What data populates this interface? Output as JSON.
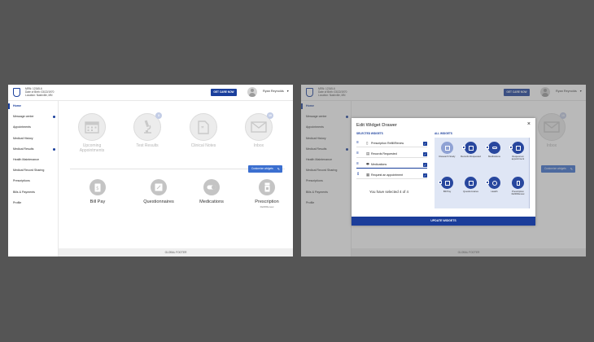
{
  "patient": {
    "mrn": "MRN: 12345-6",
    "dob": "Date of Birth: 03/22/1970",
    "location": "Location: Nashville, MN"
  },
  "header": {
    "care_button": "GET CARE NOW",
    "user_name": "Ryan Reynolds"
  },
  "sidebar": {
    "items": [
      {
        "label": "Home"
      },
      {
        "label": "Message center"
      },
      {
        "label": "Appointments"
      },
      {
        "label": "Medical History"
      },
      {
        "label": "Medical Results"
      },
      {
        "label": "Health Maintenance"
      },
      {
        "label": "Medical Record Sharing"
      },
      {
        "label": "Prescriptions"
      },
      {
        "label": "Bills & Payments"
      },
      {
        "label": "Profile"
      }
    ]
  },
  "dashboard": {
    "faint_widgets": [
      {
        "label": "Upcoming Appointments",
        "icon": "calendar-icon"
      },
      {
        "label": "Test Results",
        "icon": "microscope-icon",
        "badge": "3"
      },
      {
        "label": "Clinical Notes",
        "icon": "notes-icon"
      },
      {
        "label": "Inbox",
        "icon": "envelope-icon",
        "badge": "10"
      }
    ],
    "customize_button": "Customize widgets",
    "widgets": [
      {
        "label": "Bill Pay",
        "icon": "bill-icon"
      },
      {
        "label": "Questionnaires",
        "icon": "clipboard-icon"
      },
      {
        "label": "Medications",
        "icon": "pill-icon"
      },
      {
        "label": "Prescription",
        "sublabel": "Refill/Renew",
        "icon": "prescription-icon"
      }
    ],
    "footer": "GLOBAL FOOTER"
  },
  "modal": {
    "title": "Edit Widget Drawer",
    "close": "×",
    "selected_heading": "SELECTED WIDGETS",
    "all_heading": "ALL WIDGETS",
    "selected": [
      {
        "label": "Prescription Refill/Renew",
        "icon": "prescription-icon"
      },
      {
        "label": "Records Requested",
        "icon": "records-icon"
      },
      {
        "label": "Medications",
        "icon": "pill-icon"
      },
      {
        "label": "Request an appointment",
        "icon": "calendar-icon"
      }
    ],
    "count_text": "You have selected 4 of 4",
    "all_widgets": [
      {
        "label": "Research Study",
        "icon": "research-icon",
        "selected": false
      },
      {
        "label": "Records Requested",
        "icon": "records-icon",
        "selected": true
      },
      {
        "label": "Medications",
        "icon": "pill-icon",
        "selected": true
      },
      {
        "label": "Request an appointment",
        "icon": "calendar-icon",
        "selected": true
      },
      {
        "label": "Bill Pay",
        "icon": "bill-icon",
        "selected": false
      },
      {
        "label": "Questionnaires",
        "icon": "clipboard-icon",
        "selected": false
      },
      {
        "label": "Health",
        "icon": "apple-icon",
        "selected": false
      },
      {
        "label": "Prescription Refill/Renew",
        "icon": "prescription-icon",
        "selected": true
      }
    ],
    "update_button": "UPDATE WIDGETS"
  },
  "colors": {
    "brand": "#1a3f9c",
    "accent": "#3b6fd0",
    "backdrop": "#555555"
  }
}
